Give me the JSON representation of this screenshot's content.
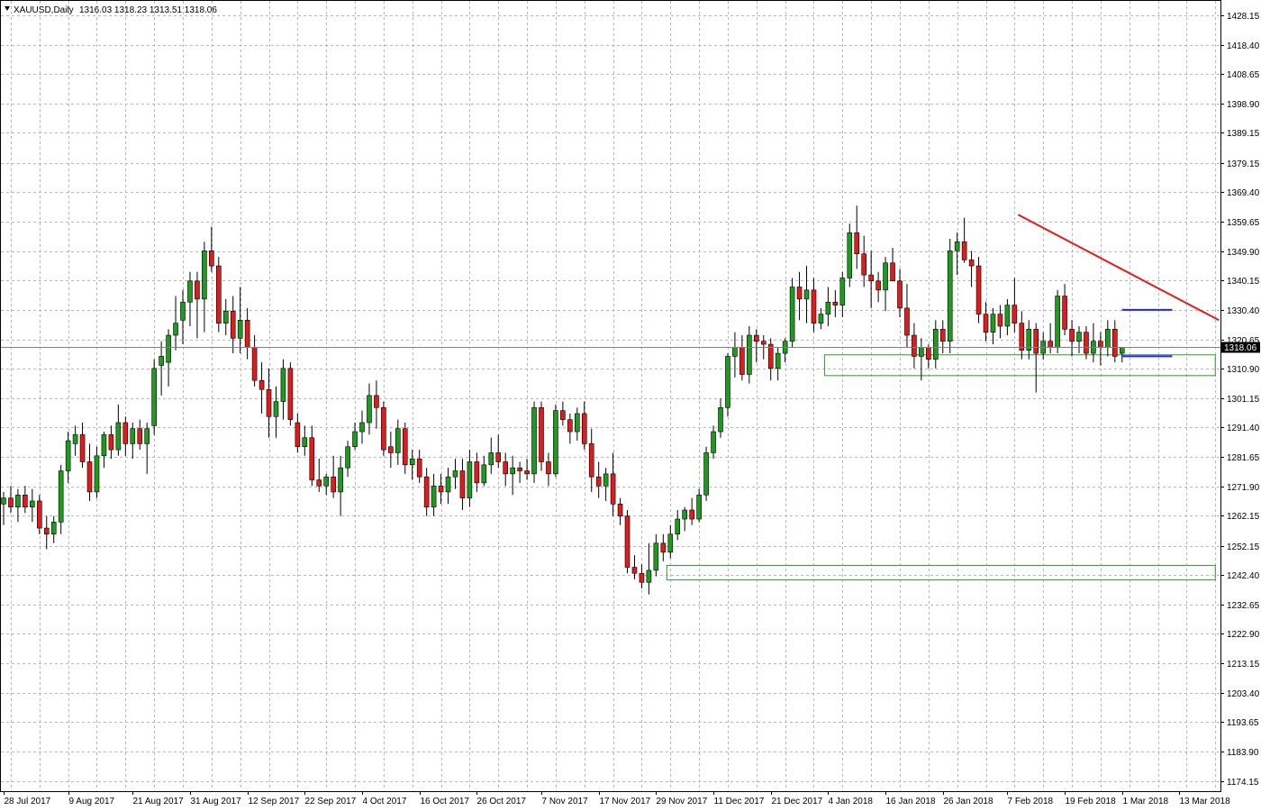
{
  "header": {
    "symbol_label": "XAUUSD,Daily",
    "ohlc_label": "1316.03 1318.23 1313.51 1318.06"
  },
  "colors": {
    "bull": "#1e9a1e",
    "bear": "#e11b1b",
    "wick": "#000000",
    "grid": "#b7b7b7",
    "trendline": "#e11b1b",
    "range_lines": "#2323ff",
    "zones": "#2e9a2e",
    "price_tag_bg": "#000000"
  },
  "chart_data": {
    "type": "candlestick",
    "symbol": "XAUUSD",
    "timeframe": "Daily",
    "current_price": 1318.06,
    "ylim": [
      1172.5,
      1436.0
    ],
    "grid": true,
    "y_ticks": [
      "1428.15",
      "1418.40",
      "1408.65",
      "1398.90",
      "1389.15",
      "1379.15",
      "1369.40",
      "1359.65",
      "1349.90",
      "1340.15",
      "1330.40",
      "1320.65",
      "1310.90",
      "1301.15",
      "1291.40",
      "1281.65",
      "1271.90",
      "1262.15",
      "1252.15",
      "1242.40",
      "1232.65",
      "1222.90",
      "1213.15",
      "1203.40",
      "1193.65",
      "1183.90",
      "1174.15"
    ],
    "x_ticks": [
      {
        "label": "28 Jul 2017",
        "bar": 0
      },
      {
        "label": "9 Aug 2017",
        "bar": 9
      },
      {
        "label": "21 Aug 2017",
        "bar": 18
      },
      {
        "label": "31 Aug 2017",
        "bar": 26
      },
      {
        "label": "12 Sep 2017",
        "bar": 34
      },
      {
        "label": "22 Sep 2017",
        "bar": 42
      },
      {
        "label": "4 Oct 2017",
        "bar": 50
      },
      {
        "label": "16 Oct 2017",
        "bar": 58
      },
      {
        "label": "26 Oct 2017",
        "bar": 66
      },
      {
        "label": "7 Nov 2017",
        "bar": 75
      },
      {
        "label": "17 Nov 2017",
        "bar": 83
      },
      {
        "label": "29 Nov 2017",
        "bar": 91
      },
      {
        "label": "11 Dec 2017",
        "bar": 99
      },
      {
        "label": "21 Dec 2017",
        "bar": 107
      },
      {
        "label": "4 Jan 2018",
        "bar": 115
      },
      {
        "label": "16 Jan 2018",
        "bar": 123
      },
      {
        "label": "26 Jan 2018",
        "bar": 131
      },
      {
        "label": "7 Feb 2018",
        "bar": 140
      },
      {
        "label": "19 Feb 2018",
        "bar": 148
      },
      {
        "label": "1 Mar 2018",
        "bar": 156
      },
      {
        "label": "13 Mar 2018",
        "bar": 164
      }
    ],
    "candles": [
      [
        1266,
        1270,
        1259,
        1268
      ],
      [
        1268,
        1272,
        1263,
        1265
      ],
      [
        1265,
        1271,
        1260,
        1269
      ],
      [
        1269,
        1272,
        1263,
        1265
      ],
      [
        1265,
        1271,
        1260,
        1267
      ],
      [
        1267,
        1269,
        1256,
        1258
      ],
      [
        1258,
        1262,
        1251,
        1256
      ],
      [
        1256,
        1262,
        1253,
        1260
      ],
      [
        1260,
        1279,
        1256,
        1277
      ],
      [
        1277,
        1290,
        1273,
        1287
      ],
      [
        1286,
        1292,
        1282,
        1289
      ],
      [
        1289,
        1293,
        1278,
        1280
      ],
      [
        1280,
        1286,
        1267,
        1270
      ],
      [
        1270,
        1285,
        1268,
        1282
      ],
      [
        1282,
        1290,
        1278,
        1289
      ],
      [
        1289,
        1292,
        1281,
        1284
      ],
      [
        1284,
        1299,
        1282,
        1293
      ],
      [
        1293,
        1295,
        1282,
        1286
      ],
      [
        1286,
        1293,
        1281,
        1291
      ],
      [
        1291,
        1294,
        1284,
        1286
      ],
      [
        1286,
        1293,
        1276,
        1291
      ],
      [
        1292,
        1314,
        1289,
        1311
      ],
      [
        1312,
        1320,
        1302,
        1315
      ],
      [
        1313,
        1324,
        1305,
        1322
      ],
      [
        1322,
        1335,
        1317,
        1326
      ],
      [
        1327,
        1337,
        1319,
        1333
      ],
      [
        1333,
        1343,
        1325,
        1340
      ],
      [
        1340,
        1343,
        1321,
        1334
      ],
      [
        1334,
        1353,
        1323,
        1350
      ],
      [
        1350,
        1358,
        1343,
        1345
      ],
      [
        1345,
        1348,
        1323,
        1326
      ],
      [
        1326,
        1334,
        1322,
        1330
      ],
      [
        1330,
        1335,
        1316,
        1321
      ],
      [
        1321,
        1338,
        1316,
        1327
      ],
      [
        1327,
        1331,
        1314,
        1318
      ],
      [
        1318,
        1322,
        1305,
        1307
      ],
      [
        1307,
        1313,
        1296,
        1304
      ],
      [
        1304,
        1311,
        1288,
        1295
      ],
      [
        1295,
        1305,
        1288,
        1300
      ],
      [
        1300,
        1314,
        1294,
        1311
      ],
      [
        1311,
        1313,
        1292,
        1294
      ],
      [
        1293,
        1296,
        1283,
        1285
      ],
      [
        1285,
        1292,
        1282,
        1288
      ],
      [
        1288,
        1292,
        1272,
        1274
      ],
      [
        1274,
        1281,
        1270,
        1272
      ],
      [
        1272,
        1276,
        1269,
        1275
      ],
      [
        1275,
        1282,
        1268,
        1270
      ],
      [
        1270,
        1282,
        1262,
        1278
      ],
      [
        1278,
        1287,
        1275,
        1285
      ],
      [
        1285,
        1293,
        1284,
        1290
      ],
      [
        1290,
        1297,
        1286,
        1293
      ],
      [
        1293,
        1306,
        1289,
        1302
      ],
      [
        1302,
        1307,
        1291,
        1298
      ],
      [
        1298,
        1300,
        1282,
        1284
      ],
      [
        1285,
        1290,
        1278,
        1283
      ],
      [
        1283,
        1294,
        1279,
        1291
      ],
      [
        1291,
        1293,
        1276,
        1279
      ],
      [
        1279,
        1284,
        1274,
        1281
      ],
      [
        1281,
        1284,
        1273,
        1275
      ],
      [
        1275,
        1278,
        1262,
        1265
      ],
      [
        1265,
        1276,
        1262,
        1272
      ],
      [
        1272,
        1276,
        1266,
        1270
      ],
      [
        1270,
        1278,
        1266,
        1275
      ],
      [
        1275,
        1281,
        1271,
        1277
      ],
      [
        1277,
        1281,
        1264,
        1268
      ],
      [
        1268,
        1284,
        1265,
        1280
      ],
      [
        1280,
        1283,
        1270,
        1273
      ],
      [
        1273,
        1282,
        1272,
        1279
      ],
      [
        1279,
        1288,
        1276,
        1283
      ],
      [
        1283,
        1289,
        1278,
        1280
      ],
      [
        1280,
        1283,
        1272,
        1276
      ],
      [
        1276,
        1282,
        1269,
        1278
      ],
      [
        1278,
        1280,
        1273,
        1277
      ],
      [
        1277,
        1281,
        1274,
        1276
      ],
      [
        1276,
        1300,
        1273,
        1298
      ],
      [
        1298,
        1300,
        1277,
        1280
      ],
      [
        1280,
        1283,
        1272,
        1276
      ],
      [
        1276,
        1299,
        1275,
        1297
      ],
      [
        1297,
        1300,
        1292,
        1294
      ],
      [
        1294,
        1296,
        1286,
        1290
      ],
      [
        1290,
        1298,
        1287,
        1296
      ],
      [
        1296,
        1300,
        1284,
        1286
      ],
      [
        1286,
        1291,
        1270,
        1275
      ],
      [
        1275,
        1280,
        1268,
        1272
      ],
      [
        1272,
        1278,
        1267,
        1276
      ],
      [
        1276,
        1283,
        1262,
        1266
      ],
      [
        1266,
        1268,
        1259,
        1262
      ],
      [
        1262,
        1264,
        1243,
        1245
      ],
      [
        1245,
        1249,
        1241,
        1243
      ],
      [
        1243,
        1246,
        1238,
        1240
      ],
      [
        1240,
        1253,
        1236,
        1244
      ],
      [
        1244,
        1256,
        1242,
        1253
      ],
      [
        1253,
        1256,
        1247,
        1250
      ],
      [
        1250,
        1259,
        1248,
        1256
      ],
      [
        1256,
        1264,
        1254,
        1261
      ],
      [
        1261,
        1265,
        1257,
        1264
      ],
      [
        1264,
        1268,
        1259,
        1261
      ],
      [
        1261,
        1271,
        1260,
        1269
      ],
      [
        1269,
        1285,
        1267,
        1283
      ],
      [
        1283,
        1292,
        1281,
        1290
      ],
      [
        1290,
        1301,
        1288,
        1298
      ],
      [
        1298,
        1316,
        1295,
        1315
      ],
      [
        1315,
        1323,
        1308,
        1318
      ],
      [
        1318,
        1322,
        1307,
        1309
      ],
      [
        1309,
        1325,
        1306,
        1322
      ],
      [
        1322,
        1324,
        1313,
        1320
      ],
      [
        1320,
        1322,
        1314,
        1319
      ],
      [
        1319,
        1321,
        1307,
        1311
      ],
      [
        1311,
        1318,
        1307,
        1316
      ],
      [
        1316,
        1321,
        1313,
        1320
      ],
      [
        1320,
        1341,
        1318,
        1338
      ],
      [
        1338,
        1343,
        1327,
        1334
      ],
      [
        1334,
        1345,
        1326,
        1337
      ],
      [
        1337,
        1341,
        1323,
        1326
      ],
      [
        1326,
        1331,
        1324,
        1329
      ],
      [
        1329,
        1338,
        1325,
        1333
      ],
      [
        1333,
        1337,
        1328,
        1332
      ],
      [
        1332,
        1343,
        1328,
        1341
      ],
      [
        1341,
        1359,
        1338,
        1356
      ],
      [
        1356,
        1365,
        1344,
        1349
      ],
      [
        1349,
        1355,
        1338,
        1342
      ],
      [
        1342,
        1350,
        1331,
        1340
      ],
      [
        1340,
        1343,
        1333,
        1337
      ],
      [
        1337,
        1348,
        1330,
        1346
      ],
      [
        1346,
        1351,
        1340,
        1340
      ],
      [
        1340,
        1344,
        1328,
        1331
      ],
      [
        1331,
        1339,
        1318,
        1322
      ],
      [
        1322,
        1326,
        1311,
        1315
      ],
      [
        1315,
        1321,
        1307,
        1318
      ],
      [
        1318,
        1319,
        1311,
        1314
      ],
      [
        1314,
        1327,
        1311,
        1324
      ],
      [
        1324,
        1327,
        1316,
        1320
      ],
      [
        1320,
        1354,
        1316,
        1350
      ],
      [
        1350,
        1356,
        1342,
        1353
      ],
      [
        1353,
        1361,
        1346,
        1347
      ],
      [
        1347,
        1350,
        1338,
        1345
      ],
      [
        1345,
        1348,
        1326,
        1329
      ],
      [
        1329,
        1333,
        1320,
        1323
      ],
      [
        1323,
        1331,
        1319,
        1329
      ],
      [
        1329,
        1332,
        1321,
        1325
      ],
      [
        1325,
        1334,
        1322,
        1332
      ],
      [
        1332,
        1341,
        1323,
        1326
      ],
      [
        1326,
        1330,
        1314,
        1317
      ],
      [
        1317,
        1327,
        1314,
        1324
      ],
      [
        1324,
        1326,
        1303,
        1316
      ],
      [
        1316,
        1323,
        1314,
        1320
      ],
      [
        1320,
        1326,
        1316,
        1318
      ],
      [
        1318,
        1337,
        1316,
        1335
      ],
      [
        1335,
        1339,
        1322,
        1324
      ],
      [
        1324,
        1327,
        1315,
        1320
      ],
      [
        1320,
        1325,
        1316,
        1323
      ],
      [
        1323,
        1325,
        1314,
        1316
      ],
      [
        1316,
        1326,
        1313,
        1320
      ],
      [
        1320,
        1323,
        1312,
        1318
      ],
      [
        1318,
        1327,
        1315,
        1324
      ],
      [
        1324,
        1327,
        1313,
        1315
      ],
      [
        1316,
        1318,
        1313,
        1318
      ]
    ],
    "annotations": {
      "trendline": {
        "from": [
          141.5,
          1362
        ],
        "to": [
          169.5,
          1327
        ]
      },
      "range_high": {
        "from": [
          156,
          1330.4
        ],
        "to": [
          163,
          1330.4
        ]
      },
      "range_low": {
        "from": [
          156,
          1315.0
        ],
        "to": [
          163,
          1315.0
        ]
      },
      "support_zone_upper": {
        "from": [
          114.5,
          1315.5
        ],
        "to": [
          169,
          1308.6
        ]
      },
      "support_zone_lower": {
        "from": [
          92.5,
          1245.6
        ],
        "to": [
          169,
          1240.8
        ]
      }
    }
  }
}
